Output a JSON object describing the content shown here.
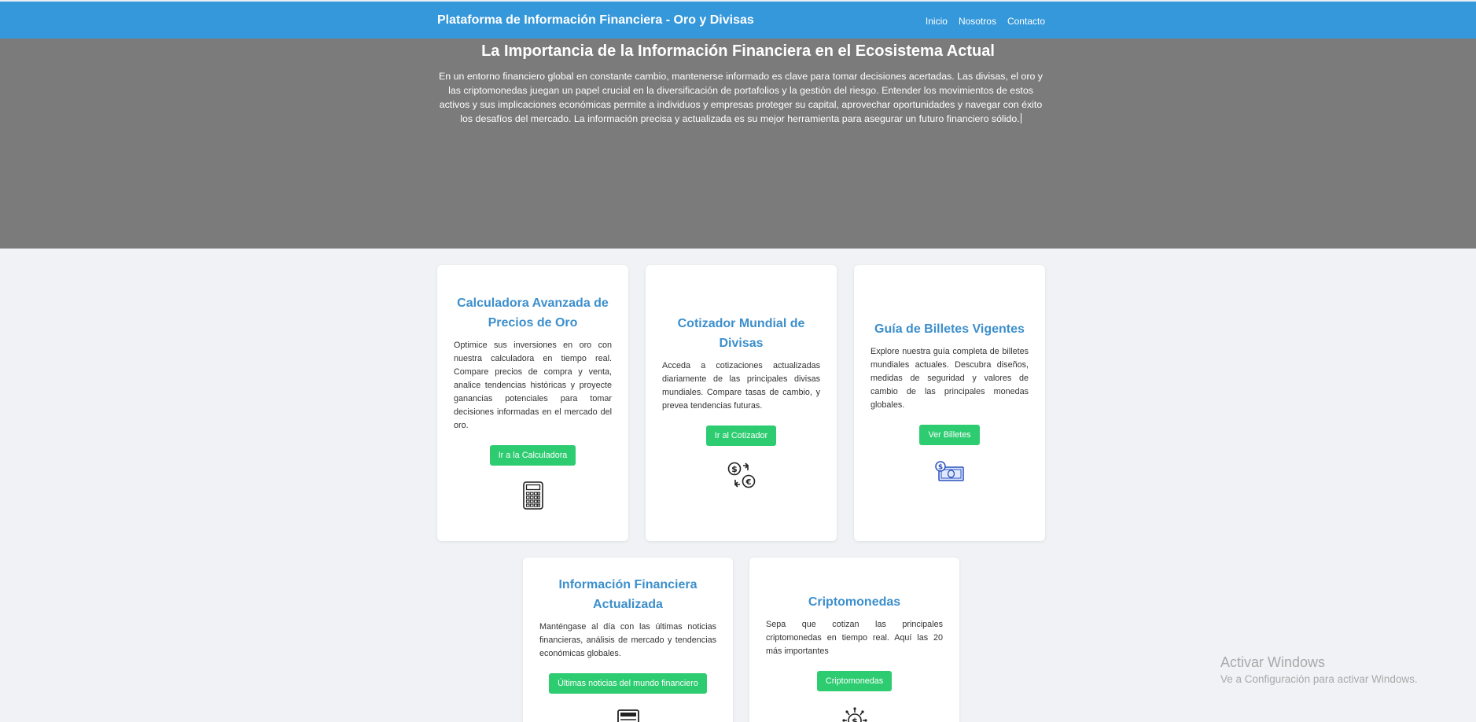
{
  "nav": {
    "brand": "Plataforma de Información Financiera - Oro y Divisas",
    "links": [
      "Inicio",
      "Nosotros",
      "Contacto"
    ]
  },
  "hero": {
    "title": "La Importancia de la Información Financiera en el Ecosistema Actual",
    "text": "En un entorno financiero global en constante cambio, mantenerse informado es clave para tomar decisiones acertadas. Las divisas, el oro y las criptomonedas juegan un papel crucial en la diversificación de portafolios y la gestión del riesgo. Entender los movimientos de estos activos y sus implicaciones económicas permite a individuos y empresas proteger su capital, aprovechar oportunidades y navegar con éxito los desafíos del mercado. La información precisa y actualizada es su mejor herramienta para asegurar un futuro financiero sólido."
  },
  "cards": [
    {
      "title": "Calculadora Avanzada de Precios de Oro",
      "text": "Optimice sus inversiones en oro con nuestra calculadora en tiempo real. Compare precios de compra y venta, analice tendencias históricas y proyecte ganancias potenciales para tomar decisiones informadas en el mercado del oro.",
      "button": "Ir a la Calculadora",
      "icon": "calculator-icon"
    },
    {
      "title": "Cotizador Mundial de Divisas",
      "text": "Acceda a cotizaciones actualizadas diariamente de las principales divisas mundiales. Compare tasas de cambio, y prevea tendencias futuras.",
      "button": "Ir al Cotizador",
      "icon": "currency-exchange-icon"
    },
    {
      "title": "Guía de Billetes Vigentes",
      "text": "Explore nuestra guía completa de billetes mundiales actuales. Descubra diseños, medidas de seguridad y valores de cambio de las principales monedas globales.",
      "button": "Ver Billetes",
      "icon": "banknote-icon"
    },
    {
      "title": "Información Financiera Actualizada",
      "text": "Manténgase al día con las últimas noticias financieras, análisis de mercado y tendencias económicas globales.",
      "button": "Últimas noticias del mundo financiero",
      "icon": "newspaper-icon"
    },
    {
      "title": "Criptomonedas",
      "text": "Sepa que cotizan las principales criptomonedas en tiempo real. Aquí las 20 más importantes",
      "button": "Criptomonedas",
      "icon": "crypto-coin-icon"
    }
  ],
  "watermark": {
    "title": "Activar Windows",
    "subtitle": "Ve a Configuración para activar Windows."
  },
  "colors": {
    "navbar": "#3498db",
    "hero": "#7b7b7b",
    "card_title": "#3c8fcc",
    "button": "#2ecc71",
    "icon_blue": "#2a52be"
  }
}
